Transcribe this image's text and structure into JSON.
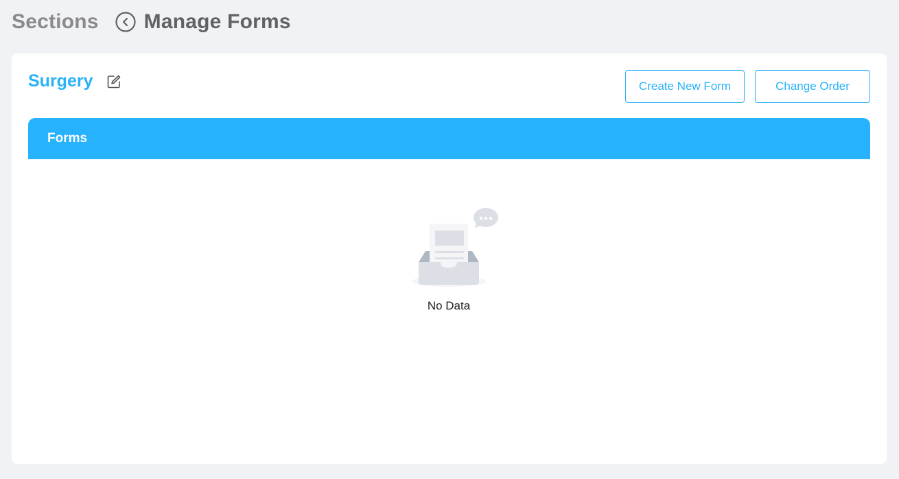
{
  "header": {
    "breadcrumb_root": "Sections",
    "title": "Manage Forms"
  },
  "section": {
    "name": "Surgery"
  },
  "toolbar": {
    "create_label": "Create New Form",
    "order_label": "Change Order"
  },
  "table": {
    "header_label": "Forms",
    "empty_text": "No Data"
  },
  "colors": {
    "accent": "#29b2f8",
    "header_band": "#27b2fd",
    "page_bg": "#f0f2f5"
  },
  "icons": {
    "back": "back-arrow-circle-icon",
    "edit": "edit-icon",
    "empty": "empty-inbox-illustration"
  }
}
